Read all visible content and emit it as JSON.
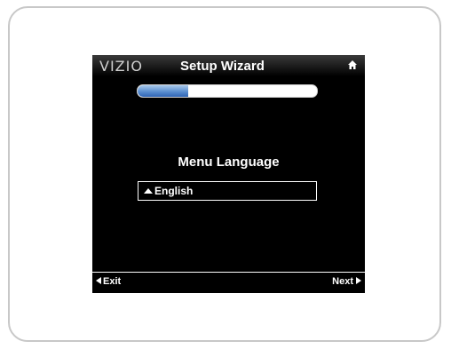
{
  "header": {
    "brand": "VIZIO",
    "title": "Setup Wizard",
    "home_icon": "home-icon"
  },
  "progress": {
    "fraction": 0.28
  },
  "menu": {
    "heading": "Menu Language",
    "selected_language": "English",
    "selector_icon": "triangle-up-icon"
  },
  "footer": {
    "exit_label": "Exit",
    "next_label": "Next",
    "exit_icon": "triangle-left-icon",
    "next_icon": "triangle-right-icon"
  },
  "colors": {
    "screen_bg": "#000000",
    "text": "#ffffff",
    "progress_fill": "#5b8fd0",
    "progress_track": "#ffffff",
    "frame_border": "#c8c8c8"
  }
}
